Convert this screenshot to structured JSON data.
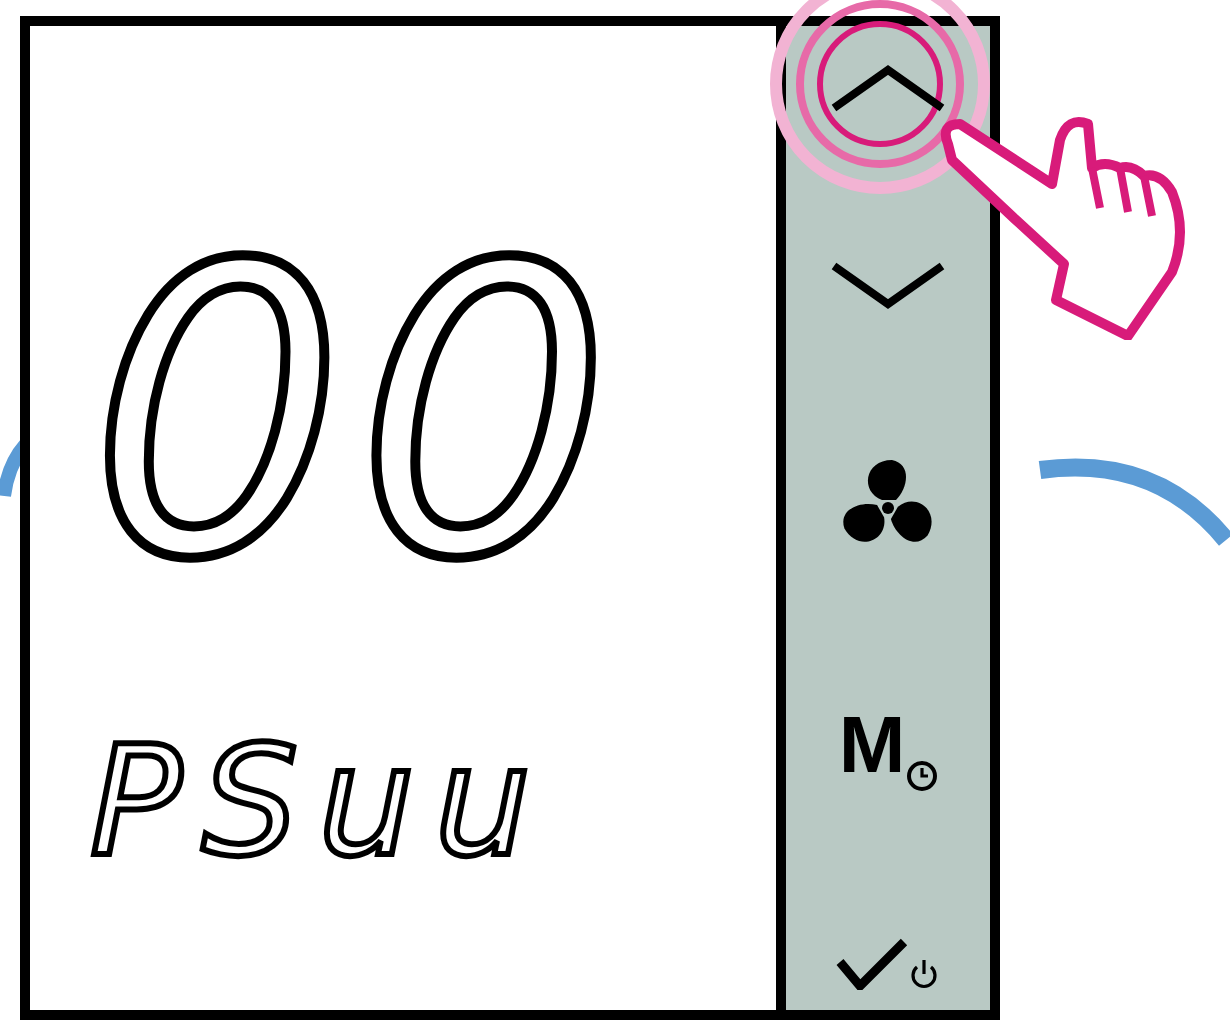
{
  "display": {
    "main_reading": "00",
    "sub_reading": "PSuu"
  },
  "buttons": [
    {
      "kind": "up",
      "pressed": true
    },
    {
      "kind": "down",
      "pressed": false
    },
    {
      "kind": "fan",
      "pressed": false
    },
    {
      "kind": "mode",
      "label": "M",
      "pressed": false
    },
    {
      "kind": "confirm_power",
      "pressed": false
    }
  ]
}
